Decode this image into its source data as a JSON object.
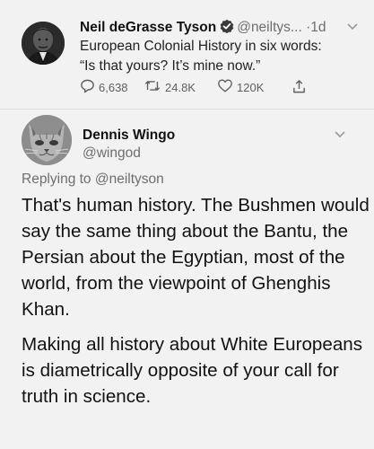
{
  "tweet": {
    "author_name": "Neil deGrasse Tyson",
    "handle": "@neiltys...",
    "separator": "·",
    "time": "1d",
    "text_line1": "European Colonial History in six words:",
    "text_line2": "“Is that yours? It’s mine now.”",
    "actions": {
      "replies": "6,638",
      "retweets": "24.8K",
      "likes": "120K"
    },
    "icons": [
      "verified-badge-icon",
      "chevron-down-icon",
      "reply-icon",
      "retweet-icon",
      "like-icon",
      "share-icon"
    ]
  },
  "reply": {
    "author_name": "Dennis Wingo",
    "handle": "@wingod",
    "replying_to": "Replying to @neiltyson",
    "paragraph1": "That's human history.  The Bushmen would say the same thing about the Bantu, the Persian about the Egyptian, most of the world, from the viewpoint of Ghenghis Khan.",
    "paragraph2": "Making all history about White Europeans is diametrically opposite of your call for truth in science."
  }
}
